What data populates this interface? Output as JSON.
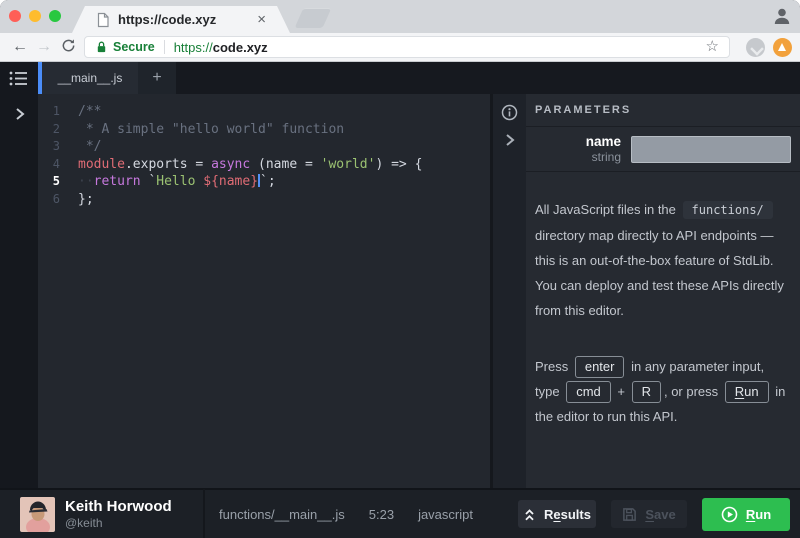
{
  "colors": {
    "accent_blue": "#4b8df8",
    "run_green": "#2dbe50",
    "secure_green": "#188038",
    "traffic_red": "#ff5f57",
    "traffic_yellow": "#febc2e",
    "traffic_green": "#28c840"
  },
  "icons": {
    "back": "←",
    "forward": "→",
    "close": "×",
    "star": "☆"
  },
  "browser": {
    "tab_title": "https://code.xyz",
    "secure_label": "Secure",
    "url_scheme": "https://",
    "url_host": "code.xyz"
  },
  "editor": {
    "tab_label": "__main__.js",
    "new_tab_label": "+",
    "lines": [
      {
        "num": "1",
        "tokens": [
          {
            "c": "comment",
            "t": "/**"
          }
        ]
      },
      {
        "num": "2",
        "tokens": [
          {
            "c": "comment",
            "t": " * A simple \"hello world\" function"
          }
        ]
      },
      {
        "num": "3",
        "tokens": [
          {
            "c": "comment",
            "t": " */"
          }
        ]
      },
      {
        "num": "4",
        "tokens": [
          {
            "c": "red",
            "t": "module"
          },
          {
            "c": "plain",
            "t": ".exports = "
          },
          {
            "c": "purple",
            "t": "async"
          },
          {
            "c": "plain",
            "t": " (name = "
          },
          {
            "c": "green",
            "t": "'world'"
          },
          {
            "c": "plain",
            "t": ") => {"
          }
        ]
      },
      {
        "num": "5",
        "active": true,
        "tokens": [
          {
            "c": "indent",
            "t": "··"
          },
          {
            "c": "purple",
            "t": "return"
          },
          {
            "c": "plain",
            "t": " `"
          },
          {
            "c": "green",
            "t": "Hello "
          },
          {
            "c": "red",
            "t": "${name}"
          },
          {
            "cursor": true
          },
          {
            "c": "plain",
            "t": "`;"
          }
        ]
      },
      {
        "num": "6",
        "tokens": [
          {
            "c": "plain",
            "t": "};"
          }
        ]
      }
    ]
  },
  "panel": {
    "header": "PARAMETERS",
    "param": {
      "name": "name",
      "type": "string",
      "value": ""
    },
    "paragraphs": [
      [
        {
          "text": "All JavaScript files in the "
        },
        {
          "code": "functions/"
        },
        {
          "text": " directory map directly to API endpoints — this is an out-of-the-box feature of StdLib. You can deploy and test these APIs directly from this editor."
        }
      ],
      [
        {
          "text": "Press "
        },
        {
          "key": "enter"
        },
        {
          "text": " in any parameter input, type "
        },
        {
          "key": "cmd"
        },
        {
          "text": " + "
        },
        {
          "key": "R"
        },
        {
          "text": ", or press "
        },
        {
          "key": "Run",
          "u": 0
        },
        {
          "text": " in the editor to run this API."
        }
      ]
    ]
  },
  "statusbar": {
    "user_name": "Keith Horwood",
    "user_handle": "@keith",
    "file_path": "functions/__main__.js",
    "cursor_position": "5:23",
    "language": "javascript",
    "results_label": "Results",
    "save_label": "Save",
    "run_label": "Run"
  }
}
